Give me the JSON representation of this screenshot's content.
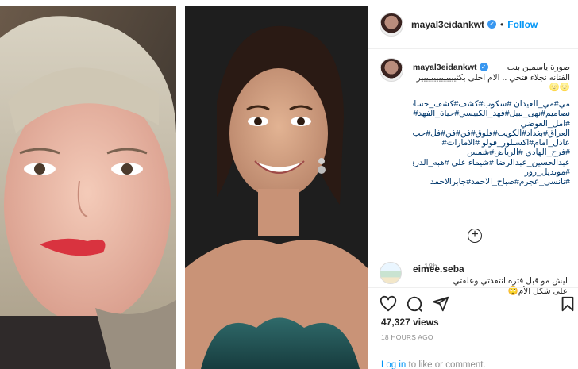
{
  "post": {
    "username": "mayal3eidankwt",
    "follow_label": "Follow",
    "separator": "•"
  },
  "caption": {
    "username": "mayal3eidankwt",
    "lines": [
      "صورة ياسمين بنت",
      "الفنانه نجلاء فتحي .. الام احلى بكثيييييييييييييير",
      "🌝🌝"
    ],
    "hashtags": [
      "مي#مي_العيدان #سكوب#كشف#كشف_حساب#",
      "نصاميم#نهى_نبيل#فهد_الكبيسي#حياة_الفهد#",
      "#امل_العوضي",
      "العراق#بغداد#الكويت#فلوق#فن#فن#فل#حب#",
      "عادل_امام#اكسبلور_فولو #الامارات#",
      "#فرح_الهادي #الرياض#شمس",
      "عبدالحسين_عبدالرضا #شيماء علي #هبه_الدري#",
      "#مونديل_روز",
      "#نانسي_عجرم#صباح_الاحمد#جابرالاحمد"
    ],
    "time": "18h"
  },
  "load_more_label": "+",
  "comment": {
    "username": "eimee.seba",
    "lines": [
      "ليش مو قبل فتره انتقدتي وعلقتي",
      "على شكل الأم🙄"
    ]
  },
  "stats": {
    "views": "47,327 views",
    "date": "18 HOURS AGO"
  },
  "login": {
    "link": "Log in",
    "text": " to like or comment."
  },
  "icons": {
    "like": "heart-icon",
    "comment": "comment-icon",
    "share": "share-icon",
    "save": "bookmark-icon",
    "verified": "verified-badge-icon"
  },
  "colors": {
    "accent": "#0095f6",
    "hashtag": "#00376b",
    "muted": "#8e8e8e"
  }
}
